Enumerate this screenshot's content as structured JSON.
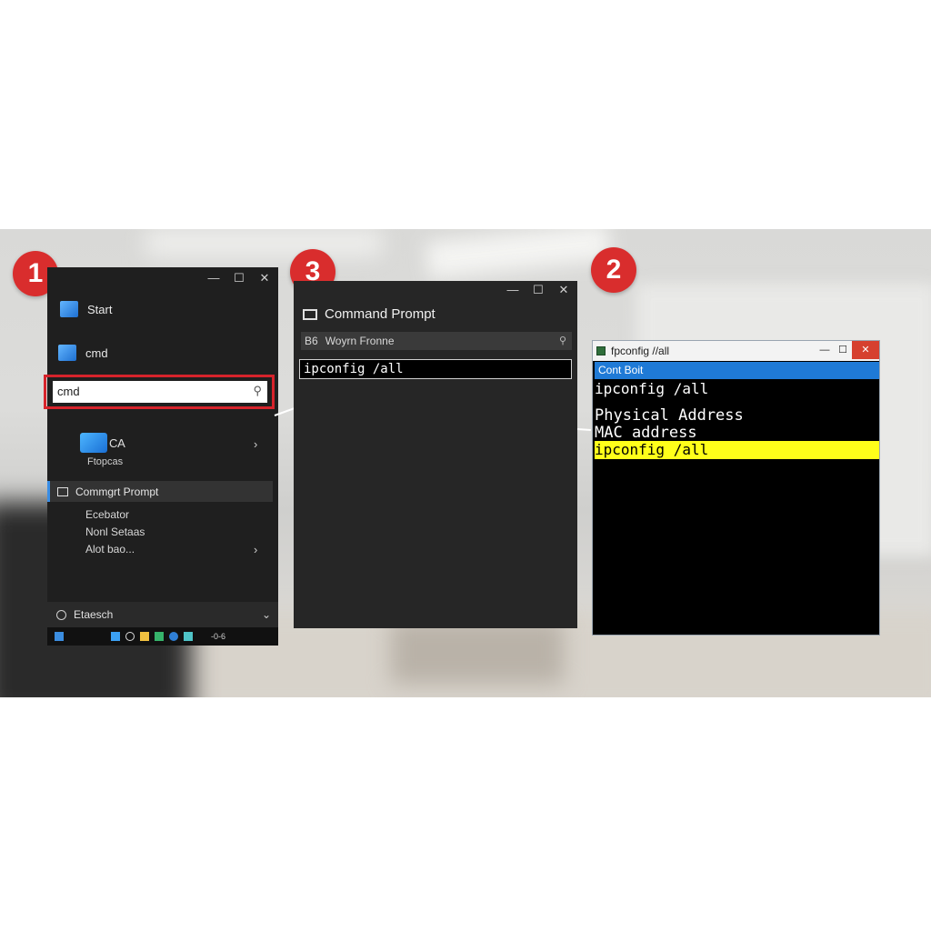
{
  "badges": [
    "1",
    "3",
    "2"
  ],
  "start_menu": {
    "window_controls": [
      "—",
      "☐",
      "✕"
    ],
    "start_label": "Start",
    "cmd_label": "cmd",
    "search": {
      "value": "cmd"
    },
    "result": {
      "title": "СА",
      "subtitle": "Ftopcas"
    },
    "command_prompt_item": "Commgrt Prompt",
    "sub_items": [
      "Ecebator",
      "Nonl Setaas",
      "Alot bao..."
    ],
    "footer_label": "Etaesch",
    "taskbar_time": "-0-6"
  },
  "command_prompt": {
    "window_controls": [
      "—",
      "☐",
      "✕"
    ],
    "title": "Command Prompt",
    "search_prefix": "B6",
    "search_text": "Woyrn Fronne",
    "input_value": "ipconfig /all"
  },
  "console": {
    "title": "fpconfig //all",
    "window_controls": [
      "—",
      "☐",
      "✕"
    ],
    "menu_text": "Cont Boit",
    "lines": {
      "line1": "ipconfig /all",
      "line2": "Physical Address",
      "line3": "MAC address",
      "line4": "ipconfig /all"
    }
  },
  "colors": {
    "badge": "#d92d2d",
    "highlight_frame": "#d6232b",
    "console_menu": "#1f7ad6",
    "console_highlight": "#ffff1a"
  }
}
